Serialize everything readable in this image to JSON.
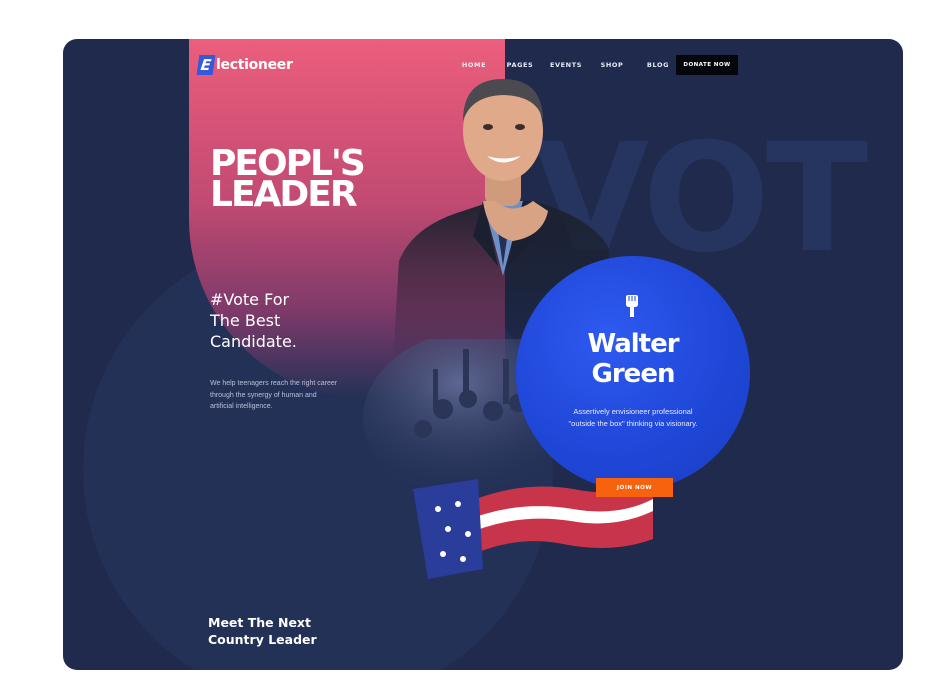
{
  "brand": {
    "mark": "E",
    "name": "lectioneer"
  },
  "nav": {
    "items": [
      {
        "label": "HOME"
      },
      {
        "label": "PAGES"
      },
      {
        "label": "EVENTS"
      },
      {
        "label": "SHOP"
      },
      {
        "label": "BLOG"
      }
    ],
    "donate_label": "DONATE NOW"
  },
  "hero": {
    "headline_line1": "PEOPL'S",
    "headline_line2": "LEADER",
    "background_word": "VOT",
    "tagline_line1": "#Vote For",
    "tagline_line2": "The Best",
    "tagline_line3": "Candidate.",
    "description": "We help teenagers reach the right career through the synergy of human and artificial intelligence.",
    "meet_line1": "Meet The Next",
    "meet_line2": "Country Leader"
  },
  "candidate": {
    "icon": "raised-fist-icon",
    "first_name": "Walter",
    "last_name": "Green",
    "description": "Assertively envisioneer professional \"outside the box\" thinking via visionary.",
    "join_label": "JOIN NOW"
  },
  "colors": {
    "background": "#1f2a4c",
    "pink_panel": "#ec5e7c",
    "circle_blue": "#2a52e8",
    "join_orange": "#f7620f",
    "logo_blue": "#3558e0",
    "donate_black": "#05060c"
  }
}
